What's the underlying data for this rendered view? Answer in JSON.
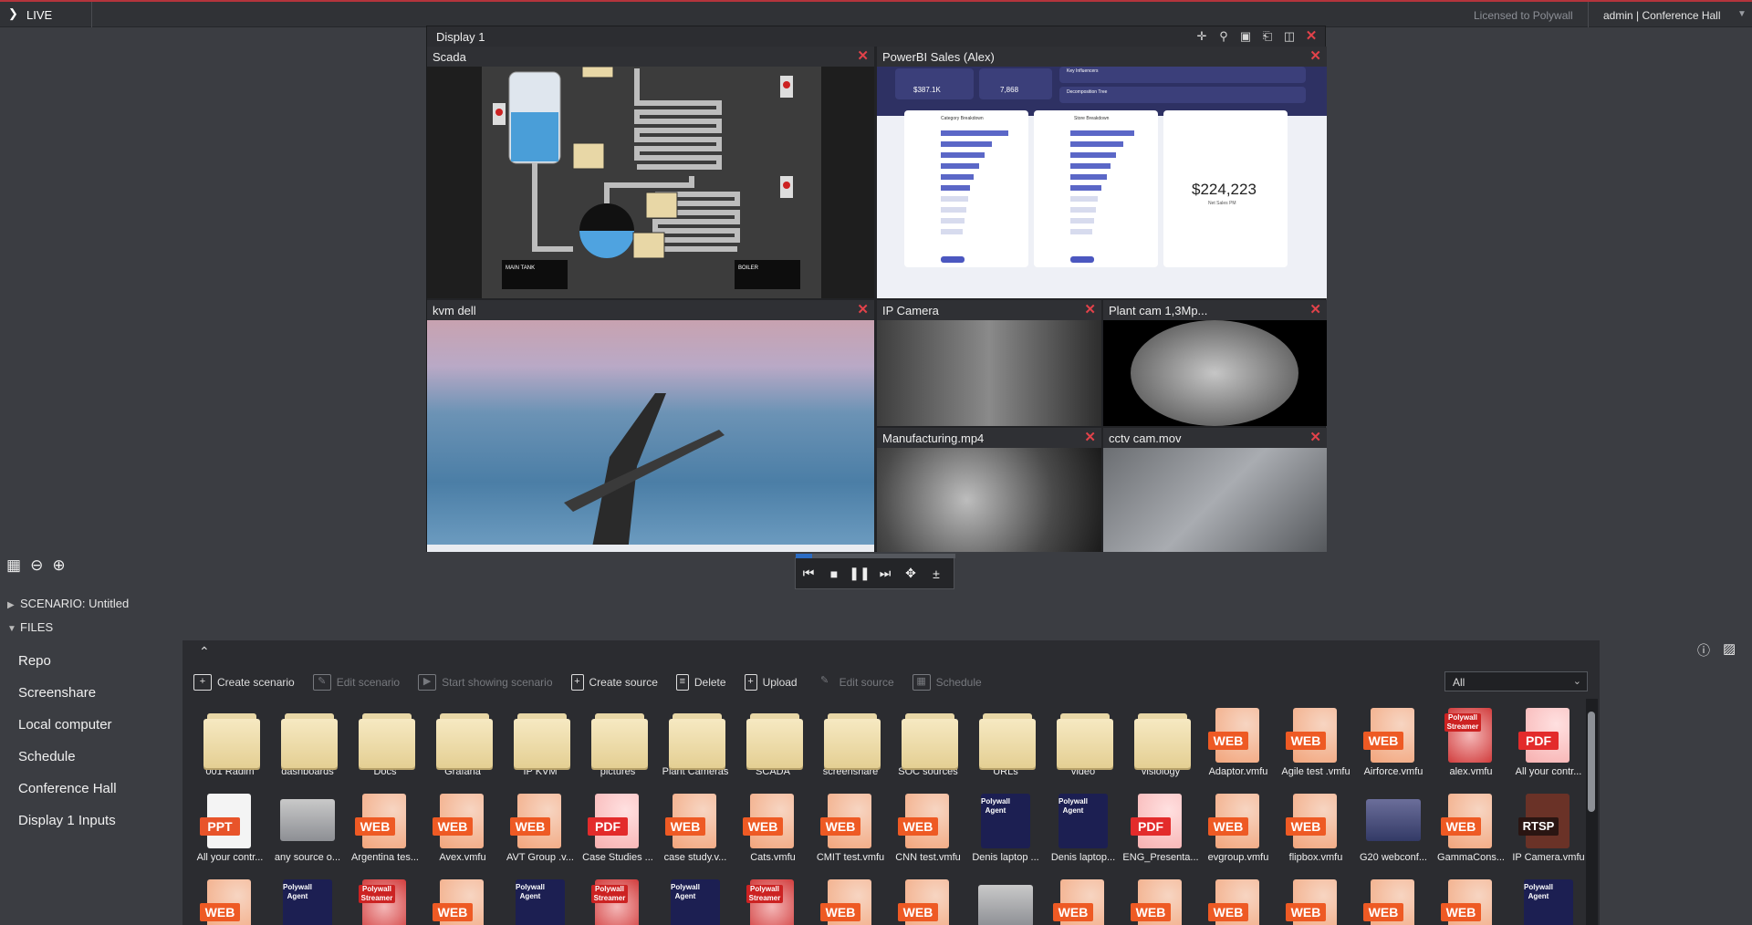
{
  "topbar": {
    "mode": "LIVE",
    "license": "Licensed to Polywall",
    "user": "admin | Conference Hall"
  },
  "display": {
    "title": "Display 1",
    "tools": [
      "add-pointer-icon",
      "zoom-icon",
      "monitor-icon",
      "exit-icon",
      "layout-icon",
      "close-icon"
    ],
    "windows": [
      {
        "title": "Scada"
      },
      {
        "title": "PowerBI Sales (Alex)"
      },
      {
        "title": "kvm dell"
      },
      {
        "title": "IP Camera"
      },
      {
        "title": "Plant cam 1,3Mp..."
      },
      {
        "title": "Manufacturing.mp4"
      },
      {
        "title": "cctv cam.mov"
      }
    ],
    "powerbi": {
      "net_sales": "$387.1K",
      "units_sold": "7,868",
      "kpi": "$224,223",
      "kpi_label": "Net Sales PM",
      "panel1": "Category Breakdown",
      "panel2": "Store Breakdown",
      "info1": "Key Influencers",
      "info2": "Decomposition Tree"
    },
    "scada": {
      "tank": "MAIN TANK",
      "boiler": "BOILER"
    }
  },
  "scenario": {
    "label": "SCENARIO: Untitled"
  },
  "files_section": {
    "label": "FILES"
  },
  "sidebar": {
    "items": [
      "Repo",
      "Screenshare",
      "Local computer",
      "Schedule",
      "Conference Hall",
      "Display 1 Inputs"
    ]
  },
  "toolbar": {
    "create_scenario": "Create scenario",
    "edit_scenario": "Edit scenario",
    "start_showing": "Start showing scenario",
    "create_source": "Create source",
    "delete": "Delete",
    "upload": "Upload",
    "edit_source": "Edit source",
    "schedule": "Schedule",
    "filter": "All"
  },
  "row1": [
    {
      "label": "001 Radim",
      "kind": "folder"
    },
    {
      "label": "dashboards",
      "kind": "folder"
    },
    {
      "label": "Docs",
      "kind": "folder"
    },
    {
      "label": "Grafana",
      "kind": "folder"
    },
    {
      "label": "IP KVM",
      "kind": "folder"
    },
    {
      "label": "pictures",
      "kind": "folder"
    },
    {
      "label": "Plant Cameras",
      "kind": "folder"
    },
    {
      "label": "SCADA",
      "kind": "folder"
    },
    {
      "label": "screenshare",
      "kind": "folder"
    },
    {
      "label": "SOC sources",
      "kind": "folder"
    },
    {
      "label": "URLs",
      "kind": "folder"
    },
    {
      "label": "video",
      "kind": "folder"
    },
    {
      "label": "visiology",
      "kind": "folder"
    },
    {
      "label": "Adaptor.vmfu",
      "kind": "web"
    },
    {
      "label": "Agile test .vmfu",
      "kind": "web"
    },
    {
      "label": "Airforce.vmfu",
      "kind": "web"
    },
    {
      "label": "alex.vmfu",
      "kind": "streamer"
    },
    {
      "label": "All your contr...",
      "kind": "pdf"
    }
  ],
  "row2": [
    {
      "label": "All your contr...",
      "kind": "ppt"
    },
    {
      "label": "any source o...",
      "kind": "thumb"
    },
    {
      "label": "Argentina tes...",
      "kind": "web"
    },
    {
      "label": "Avex.vmfu",
      "kind": "web"
    },
    {
      "label": "AVT Group .v...",
      "kind": "web"
    },
    {
      "label": "Case Studies ...",
      "kind": "pdf"
    },
    {
      "label": "case study.v...",
      "kind": "web"
    },
    {
      "label": "Cats.vmfu",
      "kind": "web"
    },
    {
      "label": "CMIT test.vmfu",
      "kind": "web"
    },
    {
      "label": "CNN test.vmfu",
      "kind": "web"
    },
    {
      "label": "Denis laptop ...",
      "kind": "agent"
    },
    {
      "label": "Denis laptop...",
      "kind": "agent"
    },
    {
      "label": "ENG_Presenta...",
      "kind": "pdf"
    },
    {
      "label": "evgroup.vmfu",
      "kind": "web"
    },
    {
      "label": "flipbox.vmfu",
      "kind": "web"
    },
    {
      "label": "G20 webconf...",
      "kind": "g20"
    },
    {
      "label": "GammaCons...",
      "kind": "web"
    },
    {
      "label": "IP Camera.vmfu",
      "kind": "rtsp"
    }
  ],
  "badges": {
    "web": "WEB",
    "pdf": "PDF",
    "ppt": "PPT",
    "rtsp": "RTSP",
    "agent": "Polywall Agent",
    "streamer": "Polywall Streamer"
  }
}
